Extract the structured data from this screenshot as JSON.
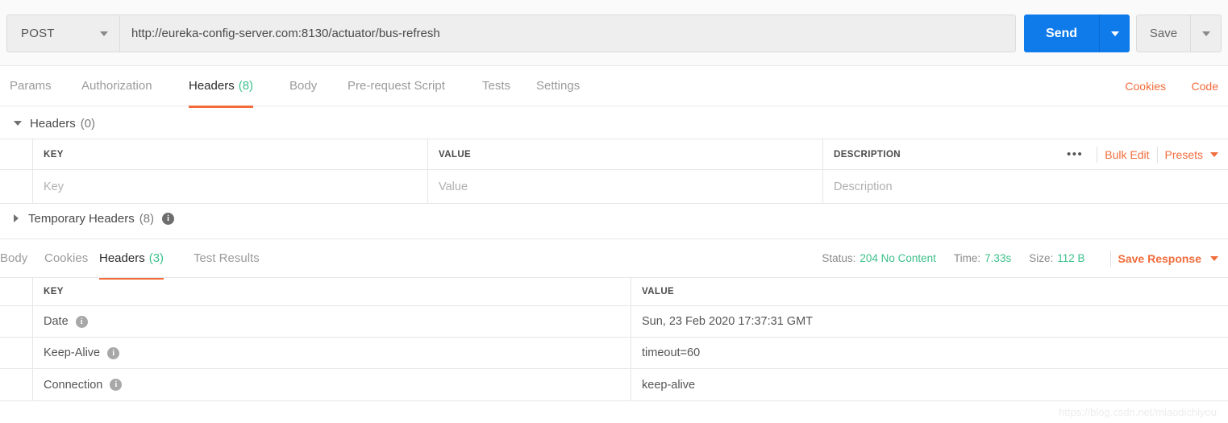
{
  "request_bar": {
    "method": "POST",
    "method_caret_icon": "chevron-down-icon",
    "url": "http://eureka-config-server.com:8130/actuator/bus-refresh",
    "url_placeholder": "Enter request URL",
    "send_label": "Send",
    "send_caret_icon": "chevron-down-icon",
    "save_label": "Save",
    "save_caret_icon": "chevron-down-icon",
    "accent_blue": "#0f7beb"
  },
  "request_tabs": {
    "items": [
      {
        "label": "Params",
        "count": "",
        "active": false
      },
      {
        "label": "Authorization",
        "count": "",
        "active": false
      },
      {
        "label": "Headers",
        "count": "(8)",
        "active": true
      },
      {
        "label": "Body",
        "count": "",
        "active": false
      },
      {
        "label": "Pre-request Script",
        "count": "",
        "active": false
      },
      {
        "label": "Tests",
        "count": "",
        "active": false
      },
      {
        "label": "Settings",
        "count": "",
        "active": false
      }
    ],
    "right_links": [
      {
        "label": "Cookies"
      },
      {
        "label": "Code"
      }
    ],
    "active_underline_color": "#f26b3a",
    "count_color": "#3dc08a"
  },
  "headers_section": {
    "toggle_icon": "triangle-down-icon",
    "title": "Headers",
    "count": "(0)",
    "columns": [
      "KEY",
      "VALUE",
      "DESCRIPTION"
    ],
    "placeholder_row": {
      "key": "Key",
      "value": "Value",
      "description": "Description"
    },
    "actions": {
      "more_icon": "ellipsis-icon",
      "more_label": "•••",
      "bulk_edit_label": "Bulk Edit",
      "presets_label": "Presets",
      "presets_caret_icon": "chevron-down-icon"
    }
  },
  "temporary_headers": {
    "toggle_icon": "triangle-right-icon",
    "title": "Temporary Headers",
    "count": "(8)",
    "info_icon": "info-icon"
  },
  "response_tabs": {
    "items": [
      {
        "label": "Body",
        "count": "",
        "active": false
      },
      {
        "label": "Cookies",
        "count": "",
        "active": false
      },
      {
        "label": "Headers",
        "count": "(3)",
        "active": true
      },
      {
        "label": "Test Results",
        "count": "",
        "active": false
      }
    ]
  },
  "response_status": {
    "status_label": "Status:",
    "status_value": "204 No Content",
    "time_label": "Time:",
    "time_value": "7.33s",
    "size_label": "Size:",
    "size_value": "112 B",
    "save_response_label": "Save Response",
    "save_response_caret_icon": "chevron-down-icon",
    "value_color": "#3dc08a"
  },
  "response_headers": {
    "columns": [
      "KEY",
      "VALUE"
    ],
    "rows": [
      {
        "key": "Date",
        "info_icon": "info-icon",
        "value": "Sun, 23 Feb 2020 17:37:31 GMT"
      },
      {
        "key": "Keep-Alive",
        "info_icon": "info-icon",
        "value": "timeout=60"
      },
      {
        "key": "Connection",
        "info_icon": "info-icon",
        "value": "keep-alive"
      }
    ]
  },
  "watermark": {
    "text": "https://blog.csdn.net/miaodichiyou"
  }
}
